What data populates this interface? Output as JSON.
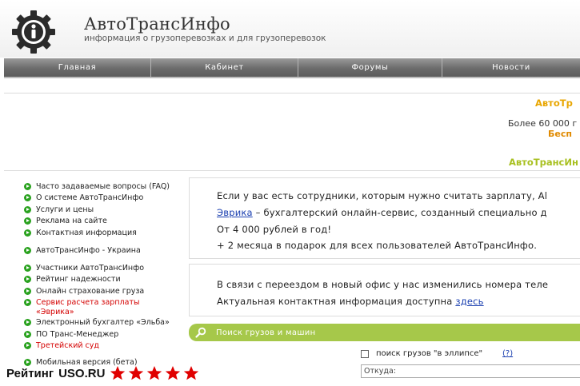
{
  "header": {
    "title": "АвтоТрансИнфо",
    "subtitle": "информация о грузоперевозках и для грузоперевозок"
  },
  "nav": [
    {
      "label": "Главная"
    },
    {
      "label": "Кабинет"
    },
    {
      "label": "Форумы"
    },
    {
      "label": "Новости"
    }
  ],
  "promo": {
    "title": "АвтоТр",
    "line1": "Более 60 000 г",
    "line2": "Бесп",
    "title2": "АвтоТрансИн"
  },
  "sidebar": {
    "items": [
      {
        "label": "Часто задаваемые вопросы (FAQ)"
      },
      {
        "label": "О системе АвтоТрансИнфо"
      },
      {
        "label": "Услуги и цены"
      },
      {
        "label": "Реклама на сайте"
      },
      {
        "label": "Контактная информация"
      },
      {
        "label": "АвтоТрансИнфо - Украина"
      },
      {
        "label": "Участники АвтоТрансИнфо"
      },
      {
        "label": "Рейтинг надежности"
      },
      {
        "label": "Онлайн страхование груза"
      },
      {
        "label": "Сервис расчета зарплаты «Эврика»"
      },
      {
        "label": "Электронный бухгалтер «Эльба»"
      },
      {
        "label": "ПО Транс-Менеджер"
      },
      {
        "label": "Третейский суд"
      },
      {
        "label": "Мобильная версия (бета)"
      }
    ]
  },
  "box1": {
    "line1": "Если у вас есть сотрудники, которым нужно считать зарплату, Al",
    "link": "Эврика",
    "line2_rest": " – бухгалтерский онлайн-сервис, созданный специально д",
    "line3": "От 4 000 рублей в год!",
    "line4": "+ 2 месяца в подарок для всех пользователей АвтоТрансИнфо."
  },
  "box2": {
    "line1": "В связи с переездом в новый офис у нас изменились номера теле",
    "line2_start": "Актуальная контактная информация доступна ",
    "link": "здесь"
  },
  "search": {
    "bar_label": "Поиск грузов и машин",
    "ellipse_label": "поиск грузов \"в эллипсе\"",
    "ellipse_help": "(?)",
    "from_placeholder": "Откуда:"
  },
  "rating": {
    "label": "Рейтинг",
    "site": "USO.RU",
    "stars": 5
  },
  "colors": {
    "accent_green": "#a6c84a",
    "bullet_green": "#2aa21f",
    "promo_orange": "#e8a600",
    "star_red": "#e00000"
  }
}
